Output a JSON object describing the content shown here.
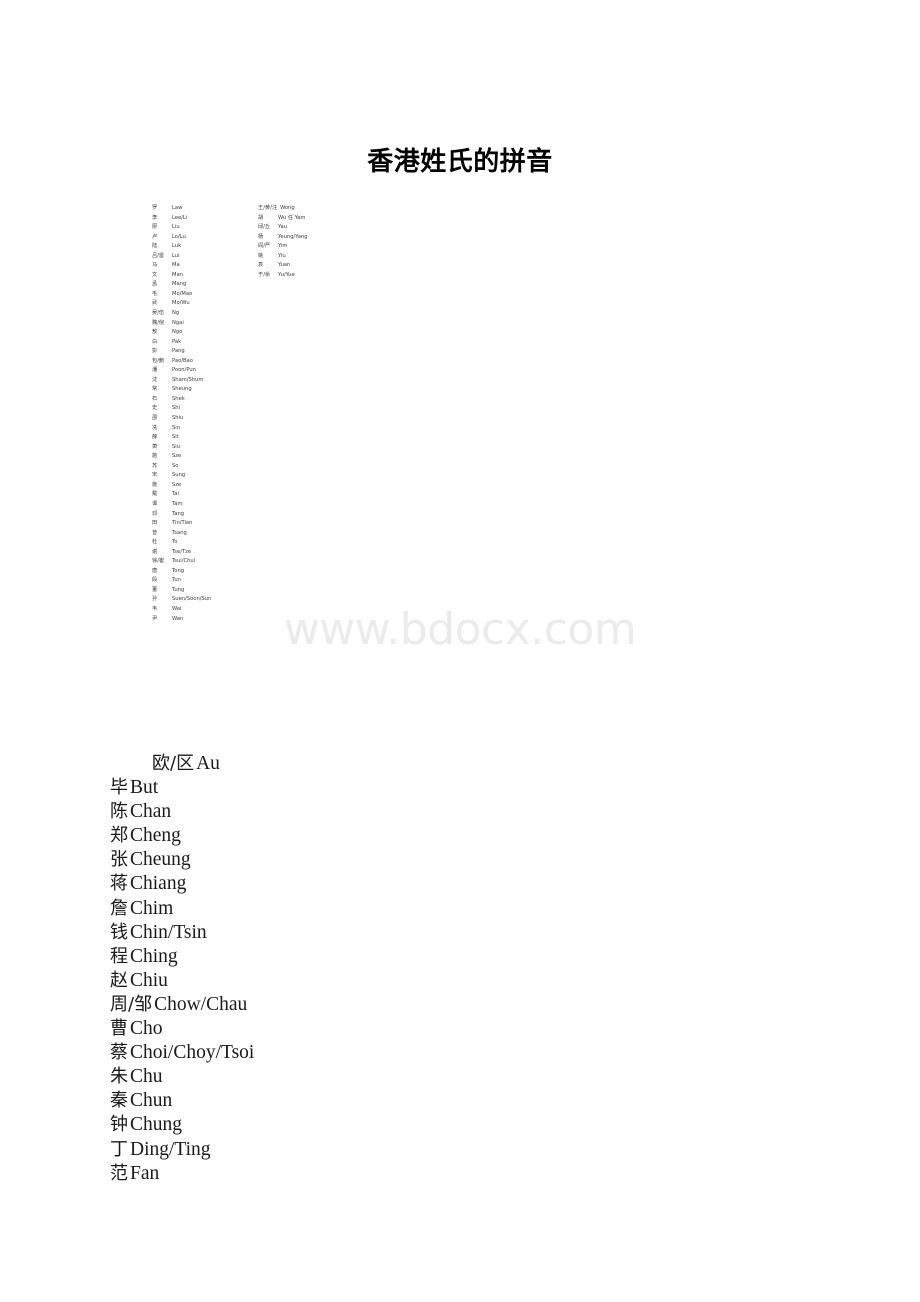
{
  "document": {
    "title": "香港姓氏的拼音",
    "watermark": "www.bdocx.com"
  },
  "small_list": {
    "left_column": [
      {
        "han": "罗",
        "rom": "Law"
      },
      {
        "han": "李",
        "rom": "Lee/Li"
      },
      {
        "han": "廖",
        "rom": "Liu"
      },
      {
        "han": "卢",
        "rom": "Lo/Lu"
      },
      {
        "han": "陆",
        "rom": "Luk"
      },
      {
        "han": "吕/雷",
        "rom": "Lui"
      },
      {
        "han": "马",
        "rom": "Ma"
      },
      {
        "han": "文",
        "rom": "Man"
      },
      {
        "han": "孟",
        "rom": "Mang"
      },
      {
        "han": "毛",
        "rom": "Mo/Mao"
      },
      {
        "han": "武",
        "rom": "Mo/Wu"
      },
      {
        "han": "吴/伍",
        "rom": "Ng"
      },
      {
        "han": "魏/倪",
        "rom": "Ngai"
      },
      {
        "han": "敖",
        "rom": "Ngo"
      },
      {
        "han": "白",
        "rom": "Pak"
      },
      {
        "han": "彭",
        "rom": "Pang"
      },
      {
        "han": "包/鲍",
        "rom": "Pao/Bao"
      },
      {
        "han": "潘",
        "rom": "Poon/Pun"
      },
      {
        "han": "沈",
        "rom": "Sham/Shum"
      },
      {
        "han": "常",
        "rom": "Sheung"
      },
      {
        "han": "石",
        "rom": "Shek"
      },
      {
        "han": "史",
        "rom": "Shi"
      },
      {
        "han": "邵",
        "rom": "Shiu"
      },
      {
        "han": "冼",
        "rom": "Sin"
      },
      {
        "han": "薛",
        "rom": "Sit"
      },
      {
        "han": "萧",
        "rom": "Siu"
      },
      {
        "han": "施",
        "rom": "Sze"
      },
      {
        "han": "苏",
        "rom": "So"
      },
      {
        "han": "宋",
        "rom": "Sung"
      },
      {
        "han": "施",
        "rom": "Sze"
      },
      {
        "han": "戴",
        "rom": "Tai"
      },
      {
        "han": "谭",
        "rom": "Tam"
      },
      {
        "han": "邓",
        "rom": "Tang"
      },
      {
        "han": "田",
        "rom": "Tin/Tian"
      },
      {
        "han": "曾",
        "rom": "Tsang"
      },
      {
        "han": "杜",
        "rom": "To"
      },
      {
        "han": "谢",
        "rom": "Tse/Tze"
      },
      {
        "han": "徐/崔",
        "rom": "Tsui/Chui"
      },
      {
        "han": "唐",
        "rom": "Tong"
      },
      {
        "han": "段",
        "rom": "Tun"
      },
      {
        "han": "董",
        "rom": "Tung"
      },
      {
        "han": "孙",
        "rom": "Suen/Soon/Sun"
      },
      {
        "han": "韦",
        "rom": "Wai"
      },
      {
        "han": "尹",
        "rom": "Wan"
      }
    ],
    "right_column": [
      {
        "han": "王/黄/汪",
        "rom": "Wong"
      },
      {
        "han": "胡",
        "rom": "Wu 任  Yam"
      },
      {
        "han": "邱/丘",
        "rom": "Yau"
      },
      {
        "han": "杨",
        "rom": "Yeung/Yang"
      },
      {
        "han": "阎/严",
        "rom": "Yim"
      },
      {
        "han": "姚",
        "rom": "Yiu"
      },
      {
        "han": "袁",
        "rom": "Yuan"
      },
      {
        "han": "于/余",
        "rom": "Yu/Yue"
      }
    ]
  },
  "big_list": [
    {
      "han": "欧/区",
      "rom": "Au",
      "indented": true
    },
    {
      "han": "毕",
      "rom": "But",
      "indented": false
    },
    {
      "han": "陈",
      "rom": "Chan",
      "indented": false
    },
    {
      "han": "郑",
      "rom": "Cheng",
      "indented": false
    },
    {
      "han": "张",
      "rom": "Cheung",
      "indented": false
    },
    {
      "han": "蒋",
      "rom": "Chiang",
      "indented": false
    },
    {
      "han": "詹",
      "rom": "Chim",
      "indented": false
    },
    {
      "han": "钱",
      "rom": "Chin/Tsin",
      "indented": false
    },
    {
      "han": "程",
      "rom": "Ching",
      "indented": false
    },
    {
      "han": "赵",
      "rom": "Chiu",
      "indented": false
    },
    {
      "han": "周/邹",
      "rom": "Chow/Chau",
      "indented": false
    },
    {
      "han": "曹",
      "rom": "Cho",
      "indented": false
    },
    {
      "han": "蔡",
      "rom": "Choi/Choy/Tsoi",
      "indented": false
    },
    {
      "han": "朱",
      "rom": "Chu",
      "indented": false
    },
    {
      "han": "秦",
      "rom": "Chun",
      "indented": false
    },
    {
      "han": "钟",
      "rom": "Chung",
      "indented": false
    },
    {
      "han": "丁",
      "rom": "Ding/Ting",
      "indented": false
    },
    {
      "han": "范",
      "rom": "Fan",
      "indented": false
    }
  ]
}
